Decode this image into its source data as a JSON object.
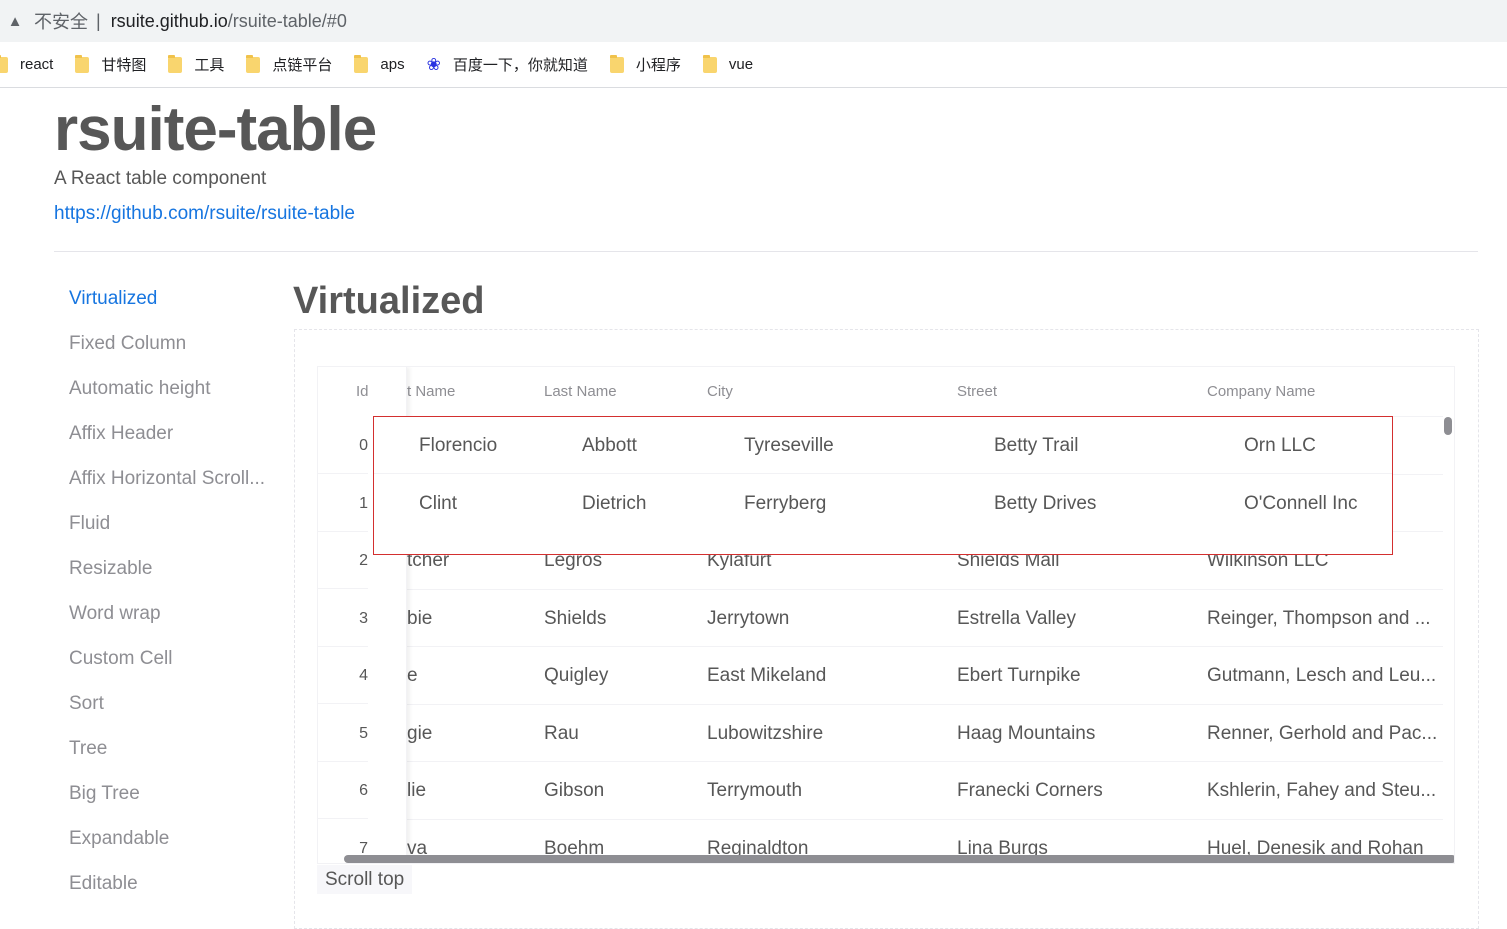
{
  "browser": {
    "security_label": "不安全",
    "url_host": "rsuite.github.io",
    "url_path": "/rsuite-table/#0",
    "bookmarks": [
      "react",
      "甘特图",
      "工具",
      "点链平台",
      "aps",
      "百度一下，你就知道",
      "小程序",
      "vue"
    ]
  },
  "header": {
    "title": "rsuite-table",
    "subtitle": "A React table component",
    "link": "https://github.com/rsuite/rsuite-table"
  },
  "sidebar": {
    "items": [
      "Virtualized",
      "Fixed Column",
      "Automatic height",
      "Affix Header",
      "Affix Horizontal Scroll...",
      "Fluid",
      "Resizable",
      "Word wrap",
      "Custom Cell",
      "Sort",
      "Tree",
      "Big Tree",
      "Expandable",
      "Editable"
    ],
    "active": "Virtualized"
  },
  "main": {
    "section_title": "Virtualized",
    "table": {
      "columns": [
        "Id",
        "t Name",
        "Last Name",
        "City",
        "Street",
        "Company Name"
      ],
      "rows": [
        [
          "0",
          "",
          "",
          "",
          "",
          ""
        ],
        [
          "1",
          "",
          "",
          "",
          "",
          ""
        ],
        [
          "2",
          "tcher",
          "Legros",
          "Kylafurt",
          "Shields Mall",
          "Wilkinson LLC"
        ],
        [
          "3",
          "bie",
          "Shields",
          "Jerrytown",
          "Estrella Valley",
          "Reinger, Thompson and ..."
        ],
        [
          "4",
          "e",
          "Quigley",
          "East Mikeland",
          "Ebert Turnpike",
          "Gutmann, Lesch and Leu..."
        ],
        [
          "5",
          "gie",
          "Rau",
          "Lubowitzshire",
          "Haag Mountains",
          "Renner, Gerhold and Pac..."
        ],
        [
          "6",
          "lie",
          "Gibson",
          "Terrymouth",
          "Franecki Corners",
          "Kshlerin, Fahey and Steu..."
        ],
        [
          "7",
          "va",
          "Boehm",
          "Reginaldton",
          "Lina Burgs",
          "Huel, Denesik and Rohan"
        ]
      ],
      "overlay_rows": [
        [
          "Florencio",
          "Abbott",
          "Tyreseville",
          "Betty Trail",
          "Orn LLC"
        ],
        [
          "Clint",
          "Dietrich",
          "Ferryberg",
          "Betty Drives",
          "O'Connell Inc"
        ]
      ]
    },
    "scroll_top_label": "Scroll top"
  },
  "colors": {
    "accent": "#1675e0",
    "highlight_border": "#d32f2f",
    "text": "#575757",
    "muted": "#8e8e93"
  }
}
